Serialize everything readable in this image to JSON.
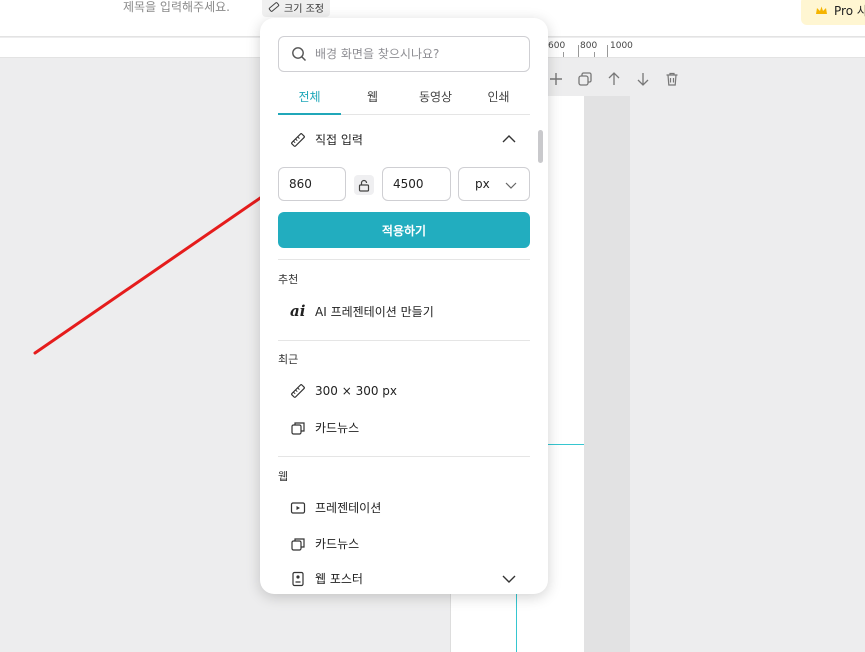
{
  "topbar": {
    "doc_title_placeholder": "제목을 입력해주세요.",
    "resize_label": "크기 조정",
    "pro_label": "Pro 사"
  },
  "ruler": {
    "labels": [
      "600",
      "800",
      "1000"
    ]
  },
  "toolbar": {
    "icons": [
      "plus-icon",
      "duplicate-icon",
      "arrow-up-icon",
      "arrow-down-icon",
      "trash-icon"
    ]
  },
  "panel": {
    "search_placeholder": "배경 화면을 찾으시나요?",
    "tabs": [
      {
        "label": "전체",
        "active": true
      },
      {
        "label": "웹",
        "active": false
      },
      {
        "label": "동영상",
        "active": false
      },
      {
        "label": "인쇄",
        "active": false
      }
    ],
    "custom": {
      "title": "직접 입력",
      "width": "860",
      "height": "4500",
      "unit": "px",
      "apply_label": "적용하기"
    },
    "recommended": {
      "heading": "추천",
      "items": [
        {
          "label": "AI 프레젠테이션 만들기",
          "icon": "ai-icon"
        }
      ]
    },
    "recent": {
      "heading": "최근",
      "items": [
        {
          "label": "300 × 300 px",
          "icon": "ruler-icon"
        },
        {
          "label": "카드뉴스",
          "icon": "cards-icon"
        }
      ]
    },
    "web": {
      "heading": "웹",
      "items": [
        {
          "label": "프레젠테이션",
          "icon": "play-icon"
        },
        {
          "label": "카드뉴스",
          "icon": "cards-icon"
        },
        {
          "label": "웹 포스터",
          "icon": "poster-icon"
        }
      ]
    }
  },
  "colors": {
    "accent": "#22adbf",
    "annotation_arrow": "#e51c1c",
    "guide": "#36c6d0"
  }
}
